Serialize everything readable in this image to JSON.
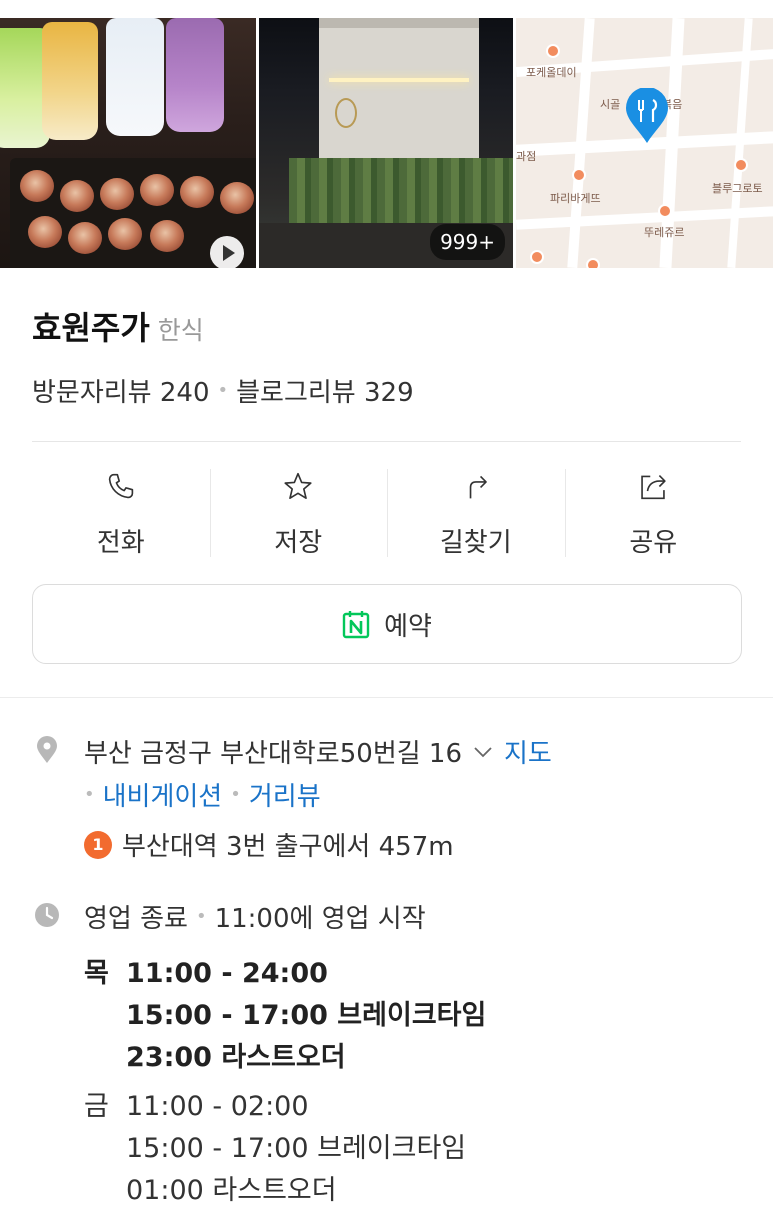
{
  "gallery": {
    "photo_count": "999+"
  },
  "map": {
    "labels": [
      "포케올데이",
      "시골",
      "볶음",
      "파리바게뜨",
      "블루그로토",
      "뚜레쥬르",
      "과점"
    ],
    "pin_color": "#1a8fe3"
  },
  "place": {
    "name": "효원주가",
    "category": "한식",
    "visitor_reviews": "방문자리뷰 240",
    "blog_reviews": "블로그리뷰 329"
  },
  "actions": [
    {
      "label": "전화",
      "icon": "phone-icon"
    },
    {
      "label": "저장",
      "icon": "star-icon"
    },
    {
      "label": "길찾기",
      "icon": "directions-icon"
    },
    {
      "label": "공유",
      "icon": "share-icon"
    }
  ],
  "reserve": {
    "label": "예약",
    "icon": "naver-calendar-icon",
    "accent": "#03c75a"
  },
  "address": {
    "text": "부산 금정구 부산대학로50번길 16",
    "map_link": "지도",
    "navigation_link": "내비게이션",
    "streetview_link": "거리뷰",
    "subway_line": "1",
    "subway_text": "부산대역 3번 출구에서 457m"
  },
  "hours": {
    "status": "영업 종료",
    "next": "11:00에 영업 시작",
    "days": [
      {
        "day": "목",
        "open": "11:00 - 24:00",
        "break": "15:00 - 17:00 브레이크타임",
        "last_order": "23:00 라스트오더"
      },
      {
        "day": "금",
        "open": "11:00 - 02:00",
        "break": "15:00 - 17:00 브레이크타임",
        "last_order": "01:00 라스트오더"
      }
    ]
  },
  "colors": {
    "link": "#1a73c8",
    "line1": "#f26b2f"
  }
}
